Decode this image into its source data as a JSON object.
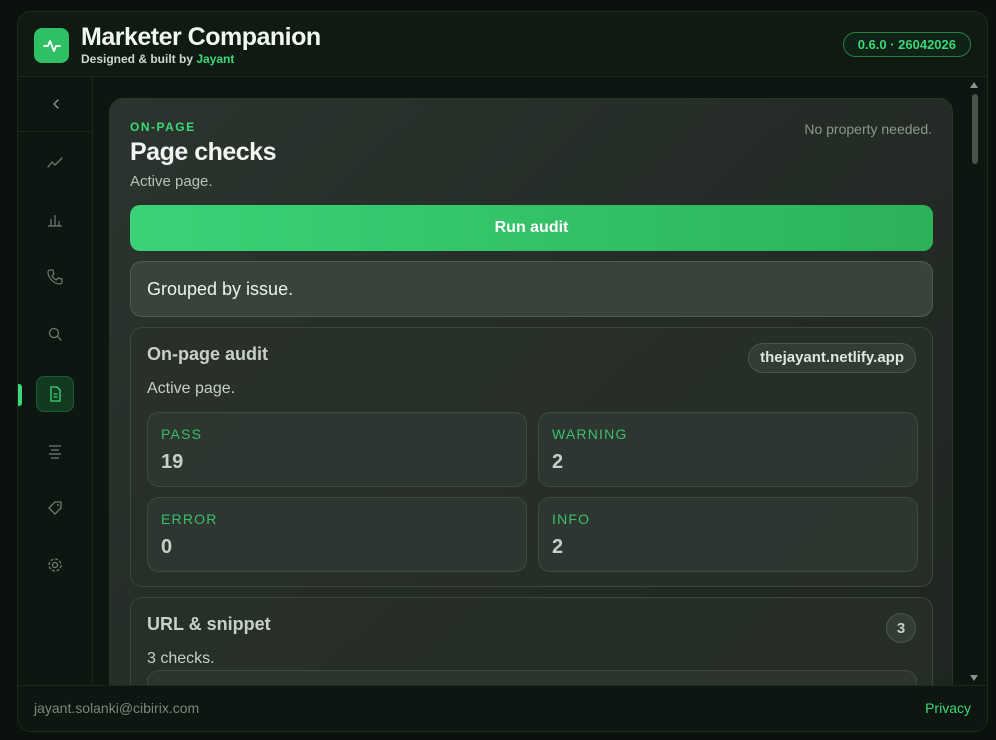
{
  "app": {
    "title": "Marketer Companion",
    "subtitle_prefix": "Designed & built by",
    "author": "Jayant",
    "version": "0.6.0 · 26042026",
    "accent_color": "#3dd878"
  },
  "sidebar": {
    "collapse_icon": "chevron-left-icon",
    "items": [
      {
        "icon": "trend-line-icon",
        "active": false
      },
      {
        "icon": "bar-chart-icon",
        "active": false
      },
      {
        "icon": "phone-icon",
        "active": false
      },
      {
        "icon": "search-icon",
        "active": false
      },
      {
        "icon": "document-icon",
        "active": true
      },
      {
        "icon": "align-center-icon",
        "active": false
      },
      {
        "icon": "tag-icon",
        "active": false
      },
      {
        "icon": "gear-icon",
        "active": false
      }
    ]
  },
  "panel": {
    "eyebrow": "ON-PAGE",
    "title": "Page checks",
    "subtitle": "Active page.",
    "note": "No property needed.",
    "run_button": "Run audit",
    "grouped_text": "Grouped by issue."
  },
  "audit_card": {
    "title": "On-page audit",
    "domain": "thejayant.netlify.app",
    "subtitle": "Active page.",
    "stats": [
      {
        "label": "PASS",
        "value": "19"
      },
      {
        "label": "WARNING",
        "value": "2"
      },
      {
        "label": "ERROR",
        "value": "0"
      },
      {
        "label": "INFO",
        "value": "2"
      }
    ]
  },
  "url_card": {
    "title": "URL & snippet",
    "count": "3",
    "subtitle": "3 checks."
  },
  "footer": {
    "email": "jayant.solanki@cibirix.com",
    "privacy": "Privacy"
  }
}
